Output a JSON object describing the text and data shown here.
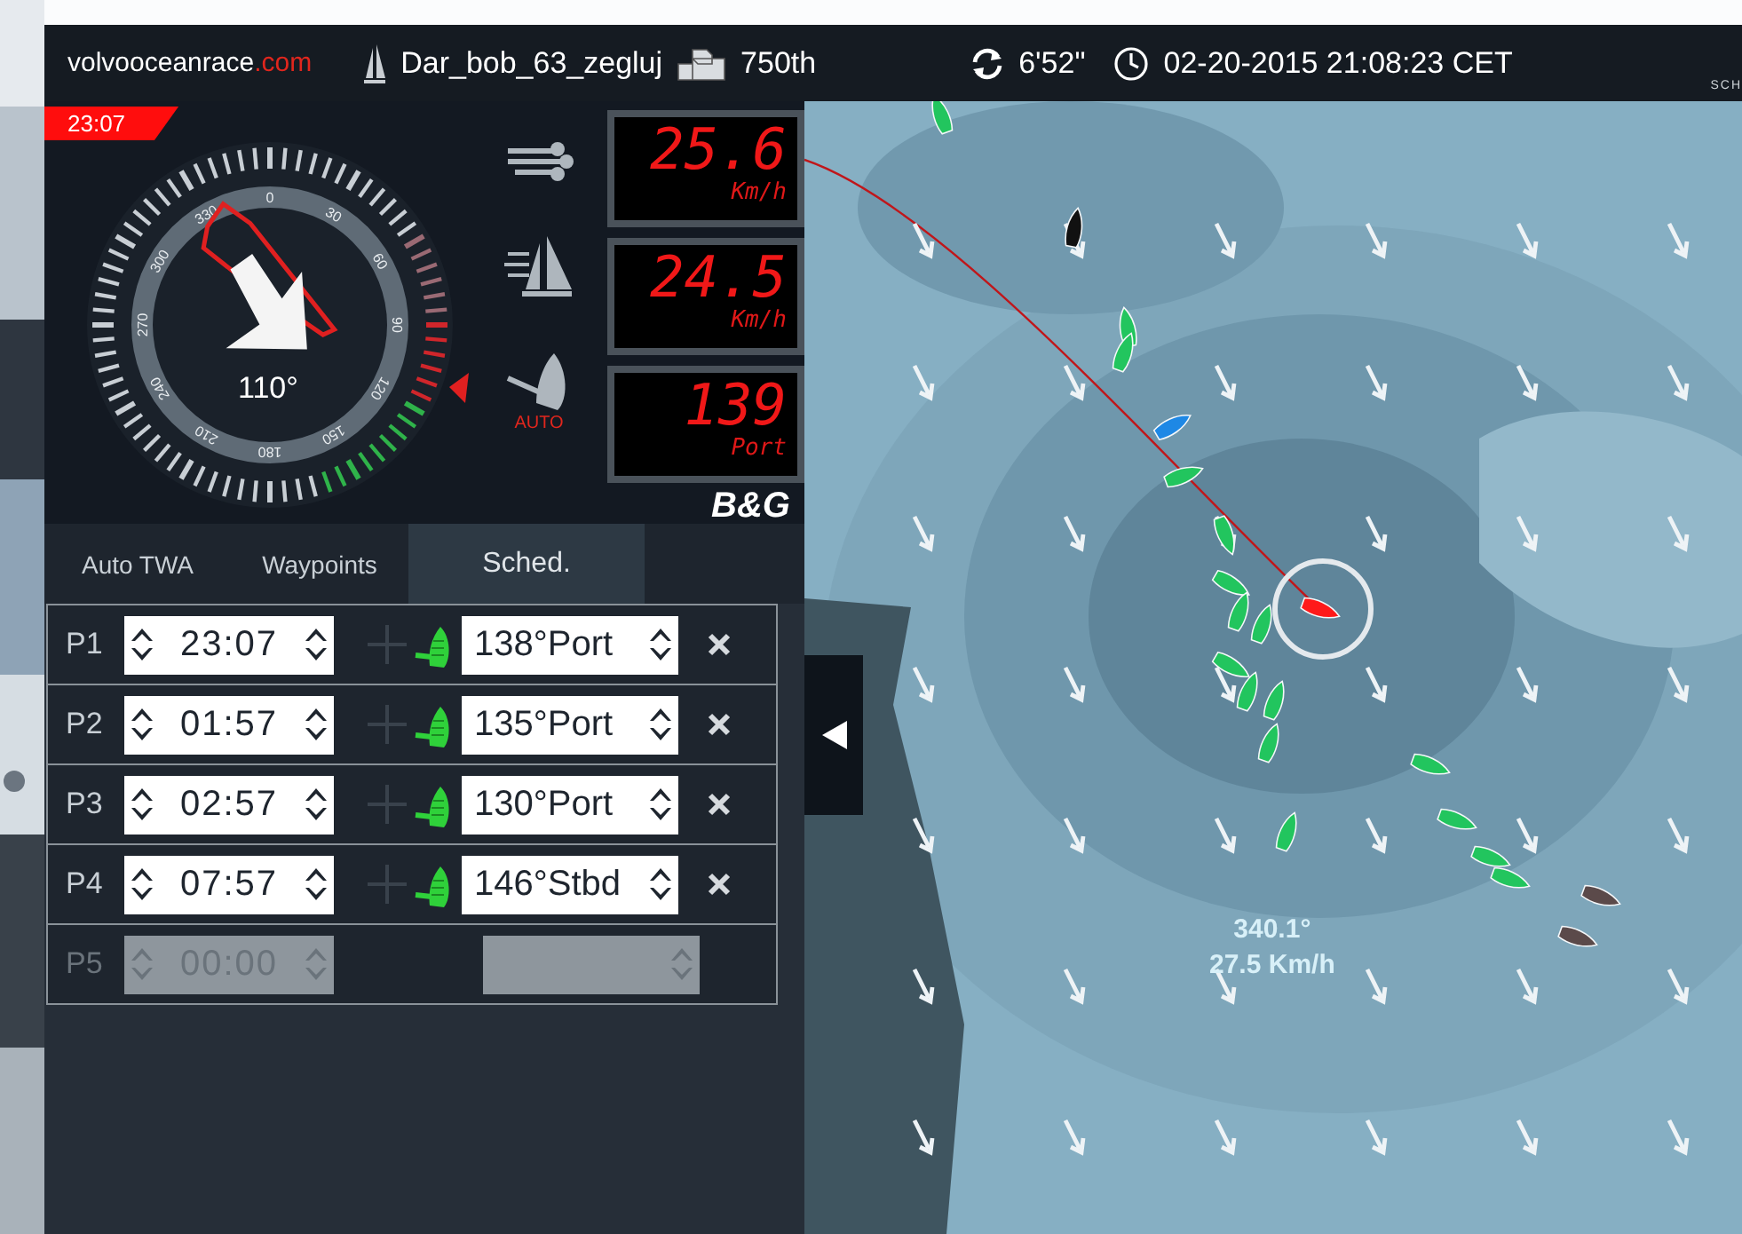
{
  "header": {
    "logo": {
      "text": "volvooceanrace",
      "accent": ".com"
    },
    "boat_name": "Dar_bob_63_zegluj",
    "rank": "750th",
    "countdown": "6'52\"",
    "datetime": "02-20-2015 21:08:23 CET",
    "corner_text": "SCH"
  },
  "instrument": {
    "time_badge": "23:07",
    "heading": "110°",
    "dial_labels": [
      "0",
      "30",
      "60",
      "90",
      "120",
      "150",
      "180",
      "210",
      "240",
      "270",
      "300",
      "330"
    ],
    "readouts": [
      {
        "value": "25.6",
        "unit": "Km/h"
      },
      {
        "value": "24.5",
        "unit": "Km/h"
      },
      {
        "value": "139",
        "unit": "Port"
      }
    ],
    "autopilot_label": "AUTO",
    "brand": "B&G"
  },
  "tabs": [
    {
      "label": "Auto TWA",
      "selected": false
    },
    {
      "label": "Waypoints",
      "selected": false
    },
    {
      "label": "Sched.",
      "selected": true
    }
  ],
  "schedule": [
    {
      "label": "P1",
      "time": "23:07",
      "angle": "138°",
      "tack": "Port",
      "disabled": false
    },
    {
      "label": "P2",
      "time": "01:57",
      "angle": "135°",
      "tack": "Port",
      "disabled": false
    },
    {
      "label": "P3",
      "time": "02:57",
      "angle": "130°",
      "tack": "Port",
      "disabled": false
    },
    {
      "label": "P4",
      "time": "07:57",
      "angle": "146°",
      "tack": "Stbd",
      "disabled": false
    },
    {
      "label": "P5",
      "time": "00:00",
      "disabled": true
    }
  ],
  "map": {
    "wind_direction": "340.1°",
    "wind_speed": "27.5 Km/h"
  }
}
